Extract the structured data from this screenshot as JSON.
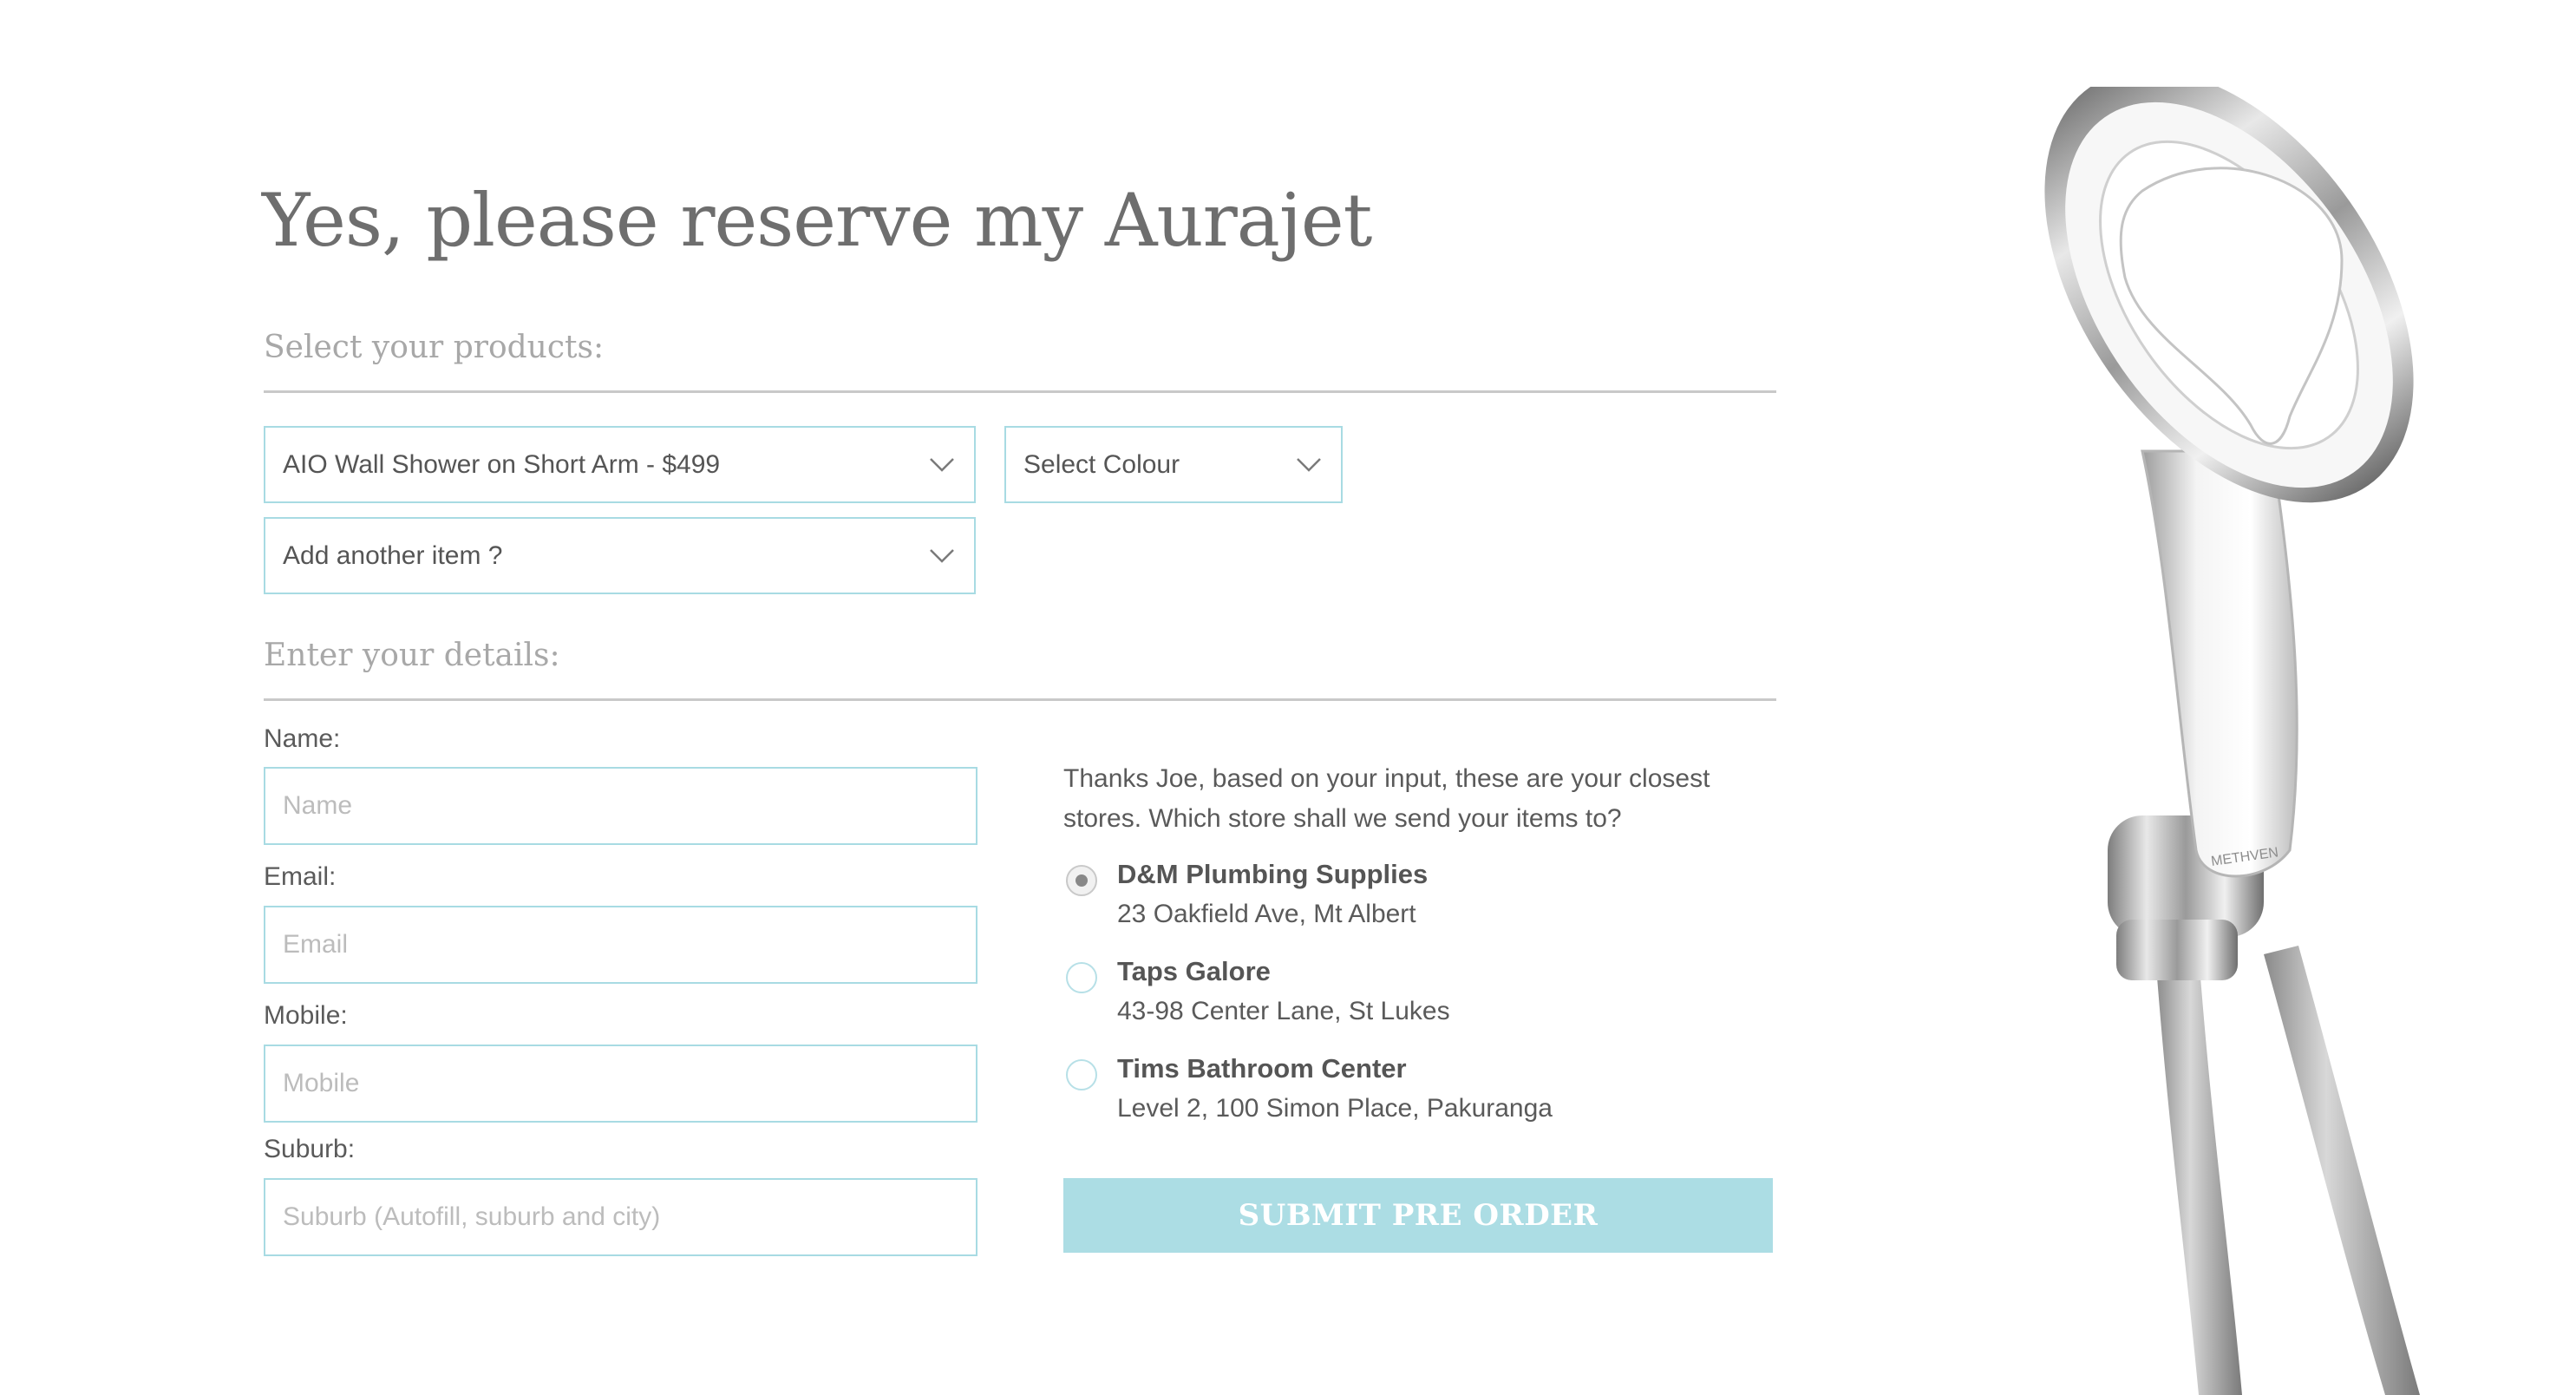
{
  "page": {
    "title": "Yes, please reserve my Aurajet"
  },
  "products": {
    "section_label": "Select your products:",
    "product_select": "AIO Wall Shower on Short Arm - $499",
    "colour_select": "Select Colour",
    "another_item_select": "Add another item ?"
  },
  "details": {
    "section_label": "Enter your details:",
    "name": {
      "label": "Name:",
      "placeholder": "Name",
      "value": ""
    },
    "email": {
      "label": "Email:",
      "placeholder": "Email",
      "value": ""
    },
    "mobile": {
      "label": "Mobile:",
      "placeholder": "Mobile",
      "value": ""
    },
    "suburb": {
      "label": "Suburb:",
      "placeholder": "Suburb (Autofill, suburb and city)",
      "value": ""
    }
  },
  "stores": {
    "intro_line1": "Thanks Joe, based on your input, these are your closest",
    "intro_line2": "stores.  Which store shall we send your items to?",
    "items": [
      {
        "name": "D&M Plumbing Supplies",
        "address": "23 Oakfield Ave, Mt Albert",
        "selected": true
      },
      {
        "name": "Taps Galore",
        "address": "43-98 Center Lane, St Lukes",
        "selected": false
      },
      {
        "name": "Tims Bathroom Center",
        "address": "Level 2, 100 Simon Place, Pakuranga",
        "selected": false
      }
    ]
  },
  "submit_label": "SUBMIT PRE ORDER",
  "product_image": {
    "brand_mark": "METHVEN"
  },
  "colors": {
    "accent_border": "#a8dbe3",
    "submit_bg": "#acdde4",
    "title_text": "#6e6e6e",
    "section_text": "#a8a8a8"
  },
  "icons": [
    "chevron-down-icon",
    "radio-icon"
  ]
}
